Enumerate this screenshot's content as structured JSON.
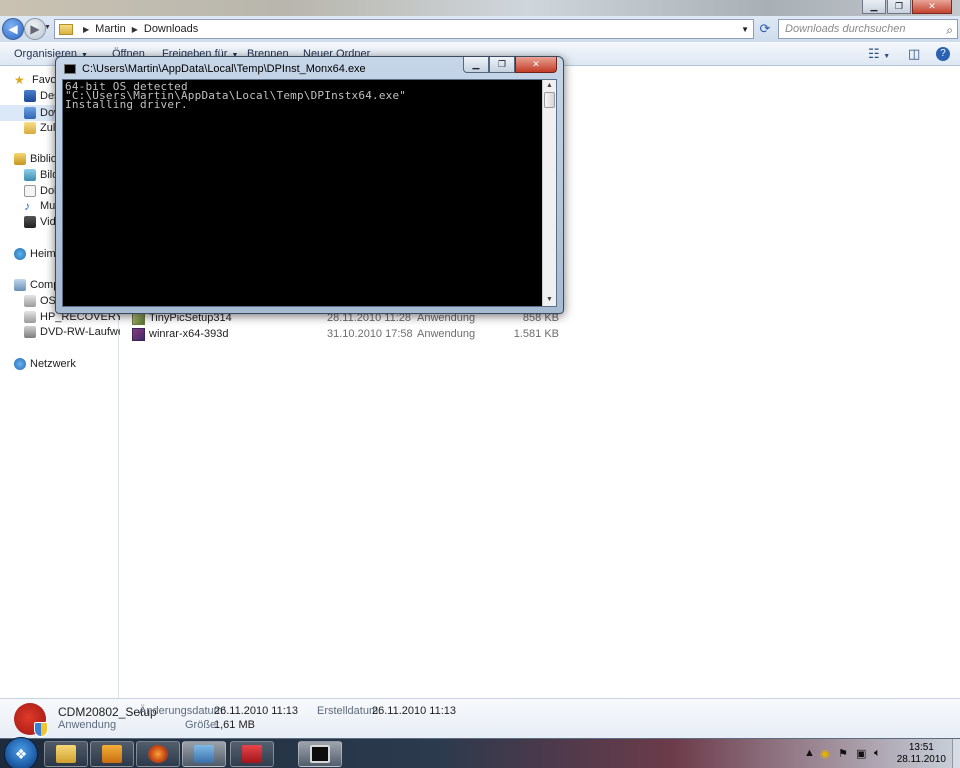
{
  "explorer": {
    "breadcrumb": [
      "Martin",
      "Downloads"
    ],
    "search_placeholder": "Downloads durchsuchen",
    "commands": {
      "organize": "Organisieren",
      "open": "Öffnen",
      "share": "Freigeben für",
      "burn": "Brennen",
      "new_folder": "Neuer Ordner"
    },
    "nav": {
      "favorites": "Favori",
      "desktop": "Desk",
      "downloads": "Dow",
      "recent": "Zule",
      "libraries": "Biblio",
      "pictures": "Bilde",
      "documents": "Doku",
      "music": "Mus",
      "videos": "Vide",
      "homegroup": "Heimr",
      "computer": "Comp",
      "os_drive": "OS (",
      "recovery": "HP_RECOVERY (D:)",
      "dvd": "DVD-RW-Laufwerk (",
      "network": "Netzwerk"
    },
    "files": [
      {
        "name": "TinyPicSetup314",
        "date": "28.11.2010 11:28",
        "type": "Anwendung",
        "size": "858 KB"
      },
      {
        "name": "winrar-x64-393d",
        "date": "31.10.2010 17:58",
        "type": "Anwendung",
        "size": "1.581 KB"
      }
    ],
    "details": {
      "name": "CDM20802_Setup",
      "type": "Anwendung",
      "modified_label": "Änderungsdatum:",
      "modified_value": "26.11.2010 11:13",
      "size_label": "Größe:",
      "size_value": "1,61 MB",
      "created_label": "Erstelldatum:",
      "created_value": "26.11.2010 11:13"
    }
  },
  "console": {
    "title": "C:\\Users\\Martin\\AppData\\Local\\Temp\\DPInst_Monx64.exe",
    "lines": [
      "64-bit OS detected",
      "\"C:\\Users\\Martin\\AppData\\Local\\Temp\\DPInstx64.exe\"",
      "Installing driver."
    ]
  },
  "taskbar": {
    "time": "13:51",
    "date": "28.11.2010"
  },
  "colors": {
    "console_bg": "#000000",
    "console_text": "#c0c0c0",
    "selection": "#dbe8f7"
  }
}
